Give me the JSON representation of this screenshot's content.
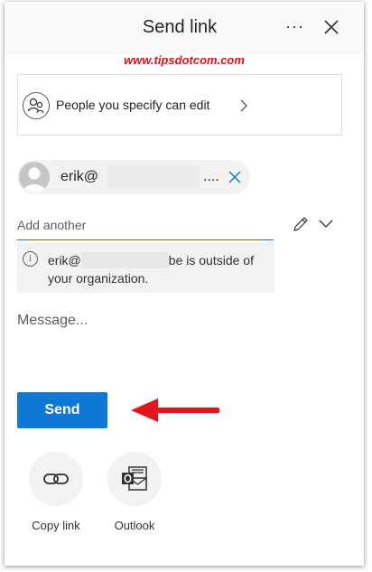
{
  "header": {
    "title": "Send link"
  },
  "watermark": "www.tipsdotcom.com",
  "permission": {
    "label": "People you specify can edit"
  },
  "recipient": {
    "name_visible": "erik@",
    "ellipsis": "...."
  },
  "add_input": {
    "placeholder": "Add another"
  },
  "warning": {
    "prefix": "erik@",
    "suffix": "be is outside of",
    "line2": "your organization."
  },
  "message": {
    "placeholder": "Message..."
  },
  "send_label": "Send",
  "share_options": [
    {
      "label": "Copy link",
      "icon": "link-icon"
    },
    {
      "label": "Outlook",
      "icon": "outlook-icon"
    }
  ],
  "colors": {
    "accent": "#0f78d4",
    "watermark": "#e0121a",
    "arrow": "#e3151a"
  }
}
